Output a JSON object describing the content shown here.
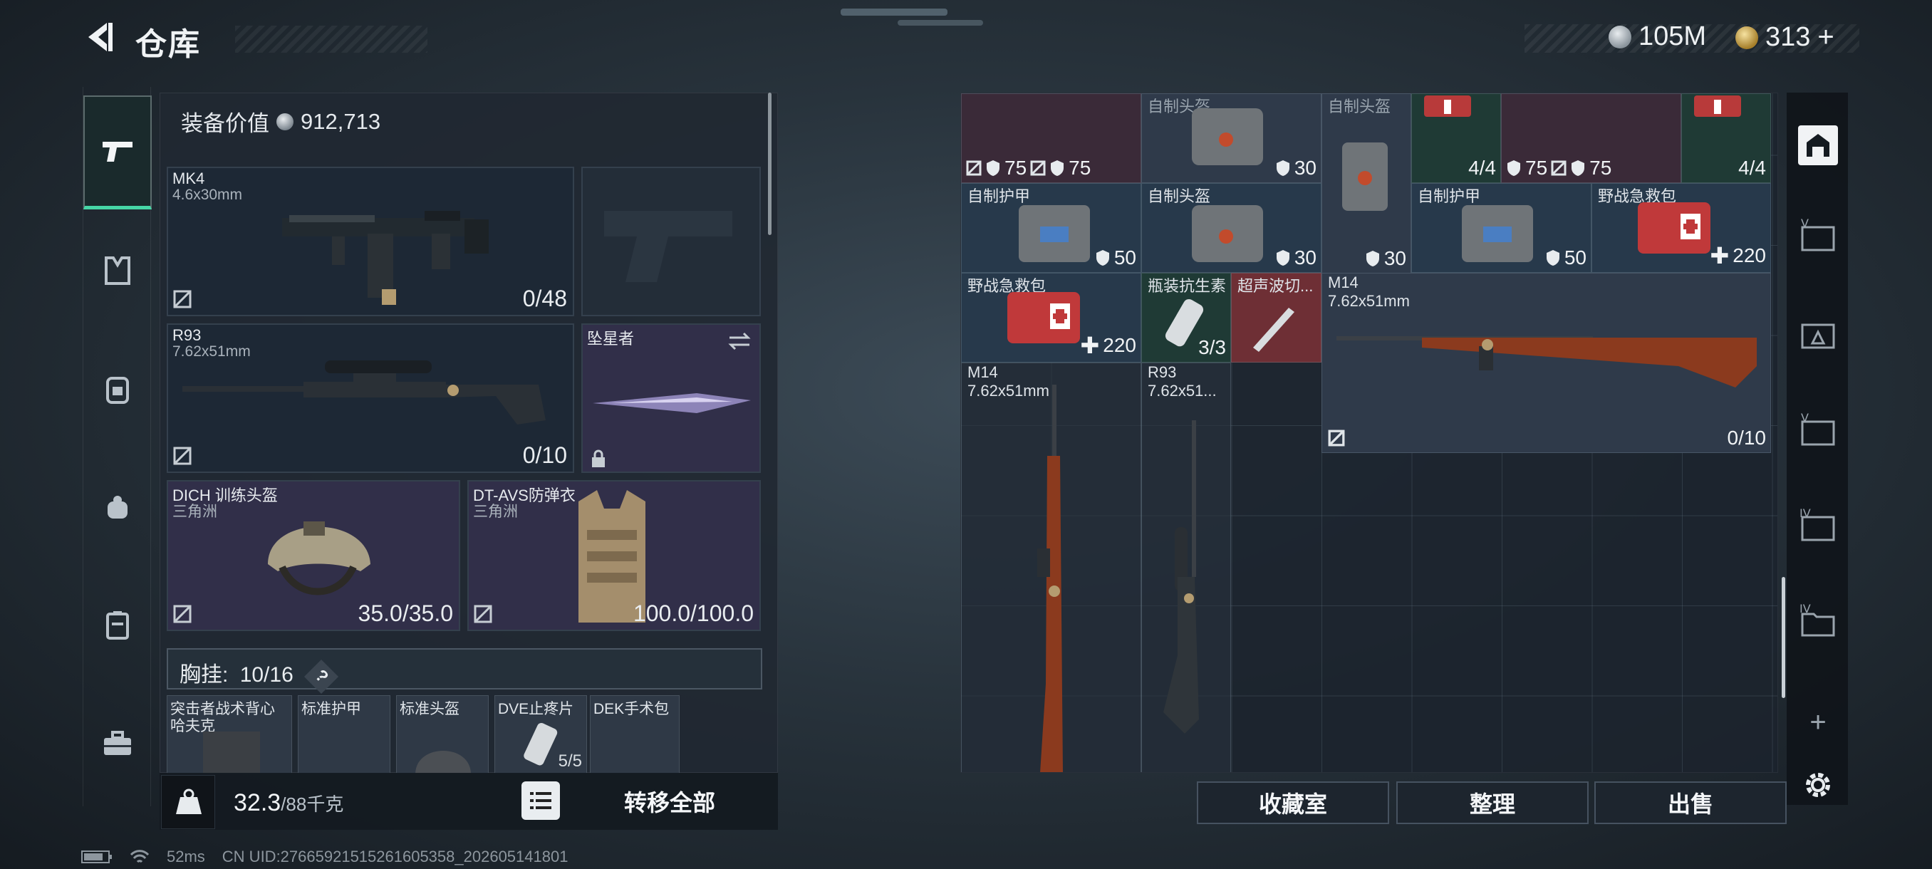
{
  "header": {
    "title": "仓库",
    "currency1": "105M",
    "currency2": "313",
    "plus": "+"
  },
  "equip": {
    "label": "装备价值",
    "value": "912,713"
  },
  "slots": {
    "mk4": {
      "name": "MK4",
      "ammo": "4.6x30mm",
      "count": "0/48"
    },
    "r93": {
      "name": "R93",
      "ammo": "7.62x51mm",
      "count": "0/10"
    },
    "melee": {
      "name": "坠星者"
    },
    "helmet": {
      "name": "DICH 训练头盔",
      "brand": "三角洲",
      "count": "35.0/35.0"
    },
    "armor": {
      "name": "DT-AVS防弹衣",
      "brand": "三角洲",
      "count": "100.0/100.0"
    }
  },
  "chest": {
    "label": "胸挂:",
    "value": "10/16",
    "help": "?"
  },
  "chest_items": [
    {
      "name": "突击者战术背心",
      "sub": "哈夫克"
    },
    {
      "name": "标准护甲"
    },
    {
      "name": "标准头盔"
    },
    {
      "name": "DVE止疼片",
      "count": "5/5"
    },
    {
      "name": "DEK手术包"
    }
  ],
  "bottom": {
    "weight": "32.3",
    "capacity": "/88千克",
    "transfer": "转移全部"
  },
  "grid": {
    "r1": [
      "75",
      "75",
      "自制头盔",
      "30",
      "自制头盔",
      "4/4",
      "75",
      "75",
      "4/4"
    ],
    "r2": [
      {
        "name": "自制护甲",
        "count": "50"
      },
      {
        "name": "自制头盔",
        "count": "30"
      },
      {
        "count": "30"
      },
      {
        "name": "自制护甲",
        "count": "50"
      },
      {
        "name": "野战急救包",
        "count": "220"
      }
    ],
    "r3": [
      {
        "name": "野战急救包",
        "count": "220"
      },
      {
        "name": "瓶装抗生素",
        "count": "3/3"
      },
      {
        "name": "超声波切..."
      },
      {
        "name": "M14",
        "sub": "7.62x51mm",
        "count": "0/10"
      }
    ],
    "r4": [
      {
        "name": "M14",
        "sub": "7.62x51mm"
      },
      {
        "name": "R93",
        "sub": "7.62x51..."
      }
    ]
  },
  "buttons": {
    "vault": "收藏室",
    "sort": "整理",
    "sell": "出售"
  },
  "status": {
    "ping": "52ms",
    "uid": "CN UID:2766592151526160535​8_202605141801"
  }
}
